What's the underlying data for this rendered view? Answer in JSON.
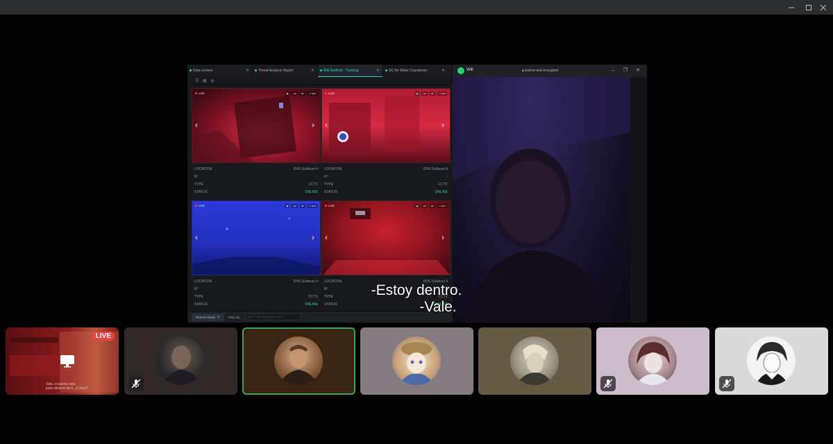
{
  "window": {
    "minimize_icon": "minimize-icon",
    "maximize_icon": "maximize-icon",
    "close_icon": "close-icon"
  },
  "shared_screen": {
    "tabs": [
      {
        "label": "Data centers",
        "active": false
      },
      {
        "label": "Threat Analysis Report",
        "active": false
      },
      {
        "label": "Will Radford - Tracking",
        "active": true
      },
      {
        "label": "DC Air Strike Countdown",
        "active": false
      }
    ],
    "cameras": [
      {
        "location_label": "LOCATION",
        "location_value": "DHS Sublevel 4",
        "ip_label": "IP",
        "ip_value": "-",
        "type_label": "TYPE",
        "type_value": "CCTV",
        "status_label": "STATUS",
        "status_value": "ONLINE",
        "live_label": "LIVE",
        "tint": "#c0283a"
      },
      {
        "location_label": "LOCATION",
        "location_value": "DHS Sublevel 4",
        "ip_label": "IP",
        "ip_value": "-",
        "type_label": "TYPE",
        "type_value": "CCTV",
        "status_label": "STATUS",
        "status_value": "ONLINE",
        "live_label": "LIVE",
        "tint": "#d22a3c"
      },
      {
        "location_label": "LOCATION",
        "location_value": "DHS Sublevel 4",
        "ip_label": "IP",
        "ip_value": "-",
        "type_label": "TYPE",
        "type_value": "CCTV",
        "status_label": "STATUS",
        "status_value": "ONLINE",
        "live_label": "LIVE",
        "tint": "#2630c8"
      },
      {
        "location_label": "LOCATION",
        "location_value": "DHS Sublevel 4",
        "ip_label": "IP",
        "ip_value": "-",
        "type_label": "TYPE",
        "type_value": "CCTV",
        "status_label": "STATUS",
        "status_value": "ONLINE",
        "live_label": "LIVE",
        "tint": "#c0232c"
      }
    ],
    "refresh_label": "Refresh feeds",
    "filter_label": "Filter By:",
    "filter_placeholder": "Type Filter Parameters Here..."
  },
  "whatsapp": {
    "contact_name": "Will",
    "encryption_text": "End-to-end encrypted"
  },
  "subtitles": {
    "line1": "-Estoy dentro.",
    "line2": "-Vale."
  },
  "participants": [
    {
      "kind": "screenshare",
      "live_label": "LIVE",
      "muted": false,
      "bg": "#7a1a1a",
      "caption_line1": "Vale, si puerta está",
      "caption_line2": "justo delante de ti. ¿Cómo?"
    },
    {
      "kind": "user",
      "muted": true,
      "bg": "#2f2a28",
      "avatar_bg": "#3a3f44",
      "selected": false
    },
    {
      "kind": "user",
      "muted": false,
      "bg": "#3a2413",
      "avatar_bg": "#b98961",
      "selected": true
    },
    {
      "kind": "user",
      "muted": false,
      "bg": "#847c80",
      "avatar_bg": "#e7d2b3",
      "selected": false
    },
    {
      "kind": "user",
      "muted": false,
      "bg": "#655a44",
      "avatar_bg": "#b9b0a0",
      "selected": false
    },
    {
      "kind": "user",
      "muted": true,
      "bg": "#cdbcca",
      "avatar_bg": "#7a4e4b",
      "selected": false
    },
    {
      "kind": "user",
      "muted": true,
      "bg": "#dadada",
      "avatar_bg": "#f2f2f2",
      "selected": false
    }
  ],
  "colors": {
    "accent_teal": "#33d1c1",
    "online_green": "#2fd29a",
    "live_red": "#ed4245",
    "speaking_green": "#3ba55d"
  }
}
